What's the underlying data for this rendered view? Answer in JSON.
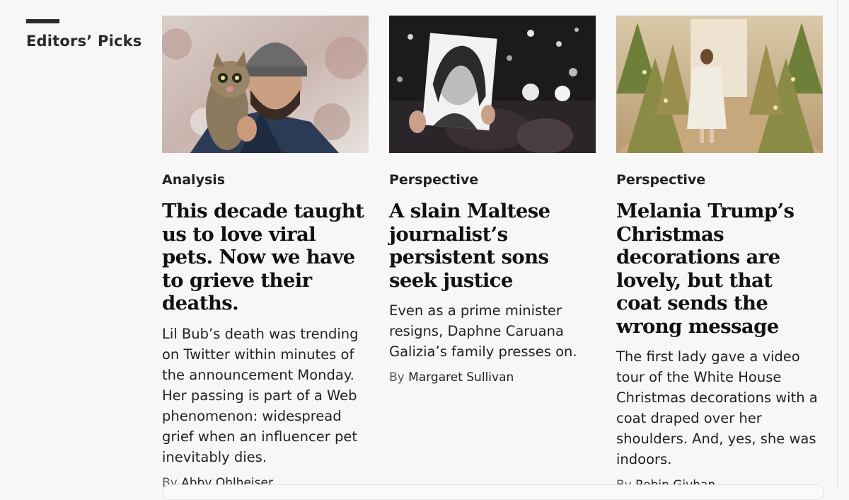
{
  "section": {
    "title": "Editors’ Picks"
  },
  "cards": [
    {
      "image_alt": "Man holding a cat in the snow",
      "kicker": "Analysis",
      "headline": "This decade taught us to love viral pets. Now we have to grieve their deaths.",
      "blurb": "Lil Bub’s death was trending on Twitter within minutes of the announcement Monday. Her passing is part of a Web phenomenon: widespread grief when an influencer pet inevitably dies.",
      "byline_prefix": "By",
      "author": "Abby Ohlheiser"
    },
    {
      "image_alt": "Portrait held up at a candlelit protest",
      "kicker": "Perspective",
      "headline": "A slain Maltese journalist’s persistent sons seek justice",
      "blurb": "Even as a prime minister resigns, Daphne Caruana Galizia’s family presses on.",
      "byline_prefix": "By",
      "author": "Margaret Sullivan"
    },
    {
      "image_alt": "Woman in white coat walking among Christmas trees",
      "kicker": "Perspective",
      "headline": "Melania Trump’s Christmas decorations are lovely, but that coat sends the wrong message",
      "blurb": "The first lady gave a video tour of the White House Christmas decorations with a coat draped over her shoulders. And, yes, she was indoors.",
      "byline_prefix": "By",
      "author": "Robin Givhan"
    }
  ],
  "colors": {
    "background": "#f7f7f7",
    "text": "#111111",
    "byline": "#555555"
  }
}
